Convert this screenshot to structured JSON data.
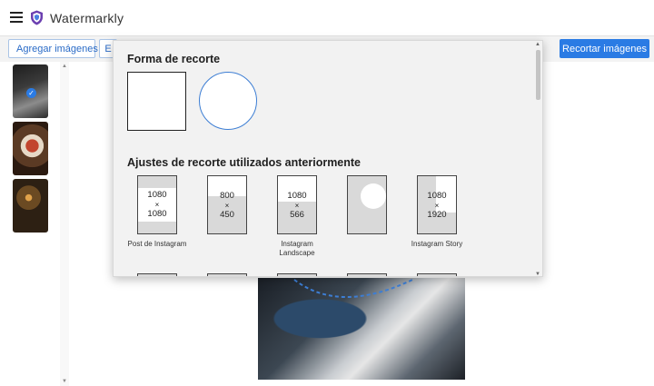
{
  "header": {
    "app_title": "Watermarkly"
  },
  "toolbar": {
    "add_images_label": "Agregar imágenes",
    "second_button_label": "E",
    "crop_images_label": "Recortar imágenes"
  },
  "popup": {
    "shape_title": "Forma de recorte",
    "shapes": [
      "square",
      "circle"
    ],
    "presets_title": "Ajustes de recorte utilizados anteriormente",
    "presets": [
      {
        "w": "1080",
        "x": "×",
        "h": "1080",
        "label": "Post de Instagram"
      },
      {
        "w": "800",
        "x": "×",
        "h": "450",
        "label": ""
      },
      {
        "w": "1080",
        "x": "×",
        "h": "566",
        "label": "Instagram Landscape"
      },
      {
        "w": "",
        "x": "",
        "h": "",
        "label": ""
      },
      {
        "w": "1080",
        "x": "×",
        "h": "1920",
        "label": "Instagram Story"
      }
    ]
  },
  "colors": {
    "accent": "#2a7be4",
    "circle_border": "#3d7ed4"
  },
  "icons": {
    "menu": "hamburger-icon",
    "logo": "shield-logo-icon",
    "check": "check-icon"
  }
}
